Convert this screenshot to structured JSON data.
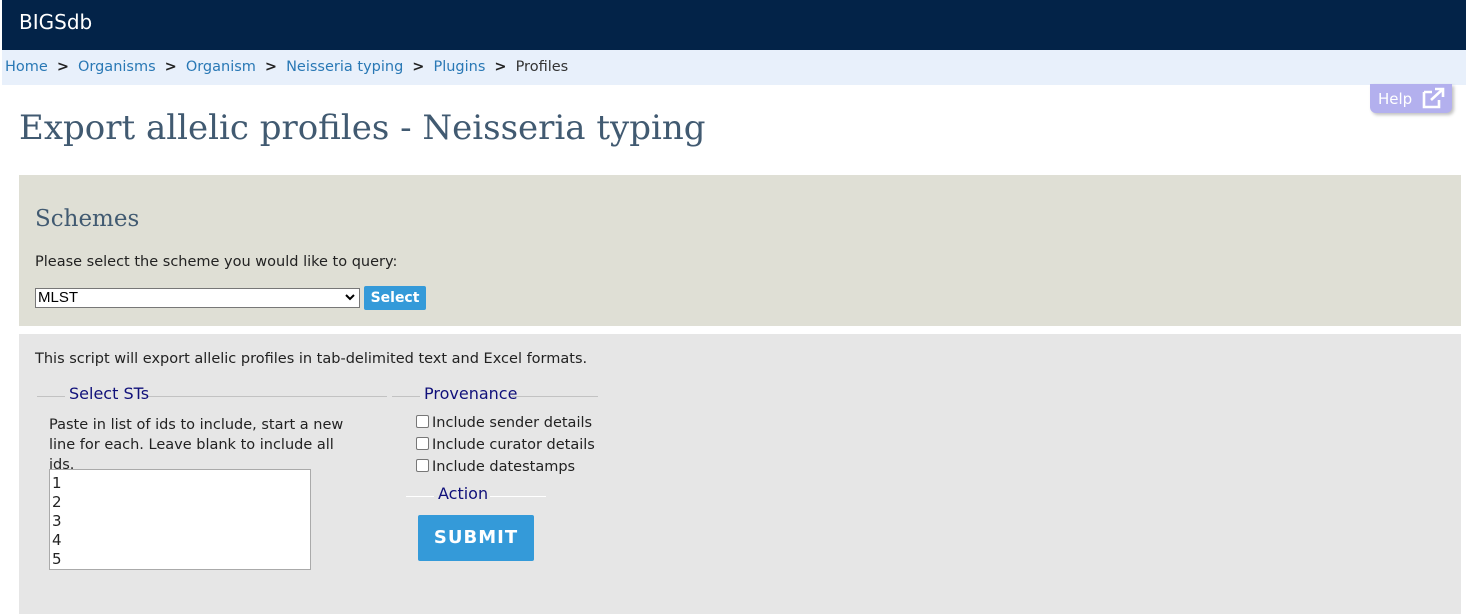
{
  "header": {
    "brand": "BIGSdb"
  },
  "breadcrumb": {
    "items": [
      "Home",
      "Organisms",
      "Organism",
      "Neisseria typing",
      "Plugins"
    ],
    "separator": ">",
    "current": "Profiles"
  },
  "help": {
    "label": "Help",
    "icon": "external-link-icon"
  },
  "page": {
    "title": "Export allelic profiles - Neisseria typing"
  },
  "schemes": {
    "heading": "Schemes",
    "prompt": "Please select the scheme you would like to query:",
    "selected": "MLST",
    "select_button": "Select"
  },
  "main": {
    "intro": "This script will export allelic profiles in tab-delimited text and Excel formats.",
    "select_sts": {
      "legend": "Select STs",
      "help": "Paste in list of ids to include, start a new line for each. Leave blank to include all ids.",
      "ids": [
        "1",
        "2",
        "3",
        "4",
        "5"
      ]
    },
    "provenance": {
      "legend": "Provenance",
      "options": [
        {
          "label": "Include sender details",
          "checked": false
        },
        {
          "label": "Include curator details",
          "checked": false
        },
        {
          "label": "Include datestamps",
          "checked": false
        }
      ]
    },
    "action": {
      "legend": "Action",
      "submit": "SUBMIT"
    }
  },
  "colors": {
    "header_bg": "#032348",
    "breadcrumb_bg": "#e8f0fb",
    "link": "#2978b5",
    "button": "#349ad9",
    "help_button": "#b3b0ee",
    "schemes_bg": "#dfdfd5",
    "main_bg": "#e6e6e6",
    "legend_text": "#10107a"
  }
}
